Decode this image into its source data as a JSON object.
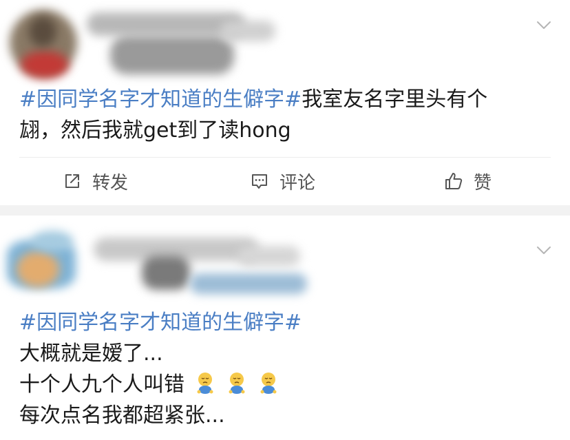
{
  "posts": [
    {
      "header": {
        "menu_icon": "chevron-down-icon"
      },
      "hashtag": "#因同学名字才知道的生僻字#",
      "content_line1": "我室友名字里头有个",
      "content_line2": "翃，然后我就get到了读hong",
      "actions": {
        "repost_icon": "share-icon",
        "repost_label": "转发",
        "comment_icon": "comment-icon",
        "comment_label": "评论",
        "like_icon": "thumbs-up-icon",
        "like_label": "赞"
      }
    },
    {
      "header": {
        "menu_icon": "chevron-down-icon"
      },
      "hashtag": "#因同学名字才知道的生僻字#",
      "lines": [
        "大概就是嫒了...",
        "十个人九个人叫错",
        "每次点名我都超紧张..."
      ],
      "emoji_name": "sad-sitting-emoji"
    }
  ],
  "colors": {
    "hashtag": "#4a7ec4",
    "separator": "#f2f2f2",
    "text": "#1a1a1a"
  }
}
